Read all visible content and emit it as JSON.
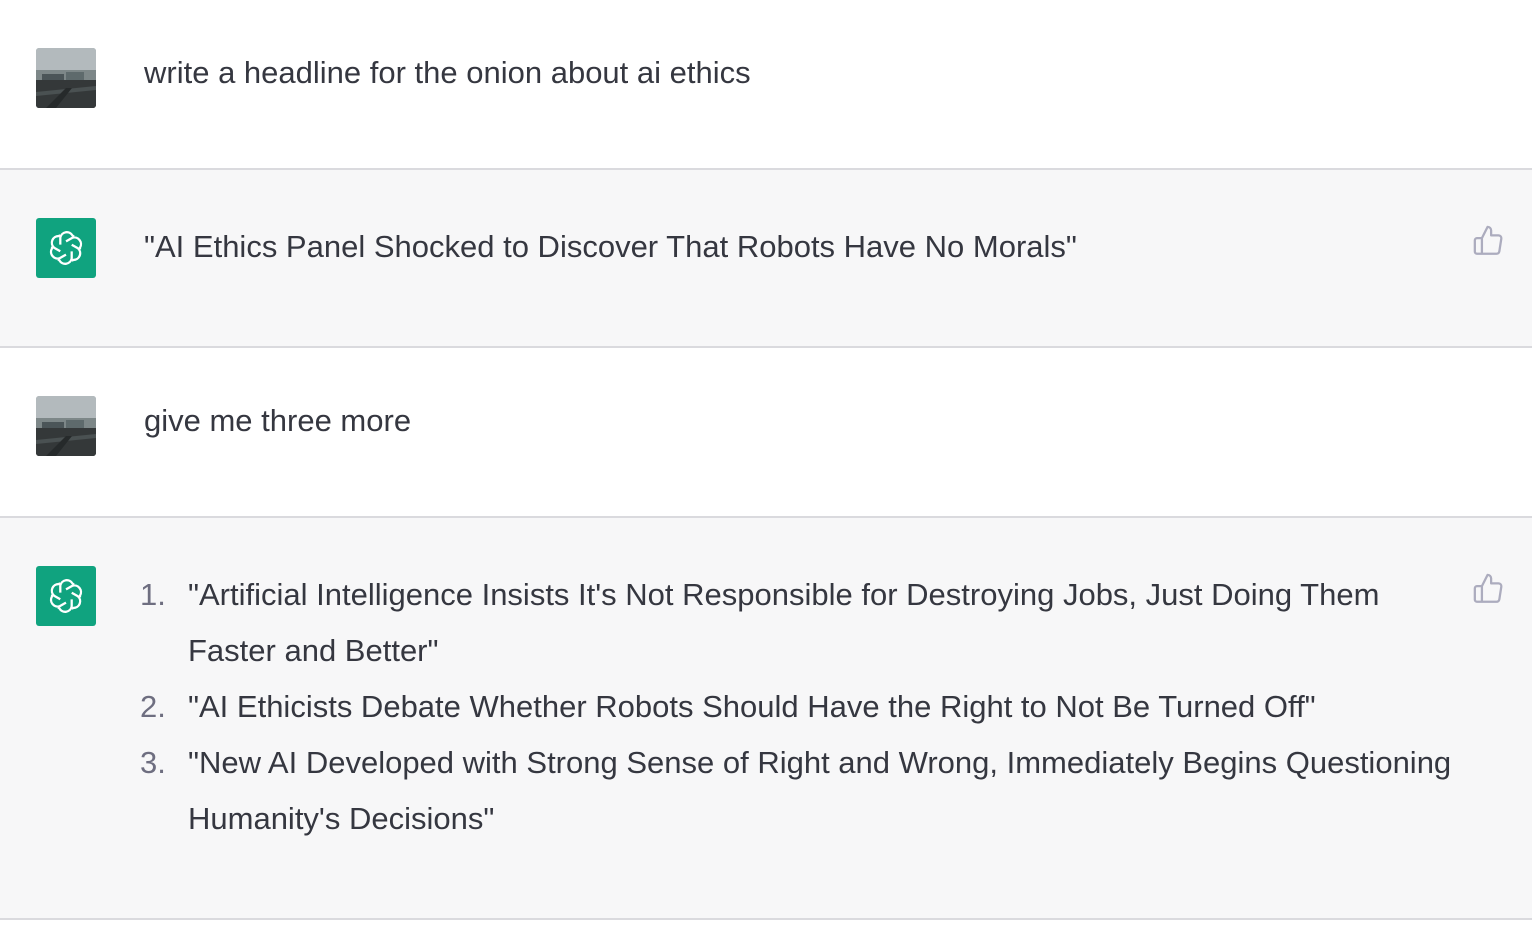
{
  "conversation": {
    "messages": [
      {
        "role": "user",
        "text": "write a headline for the onion about ai ethics"
      },
      {
        "role": "assistant",
        "text": "\"AI Ethics Panel Shocked to Discover That Robots Have No Morals\""
      },
      {
        "role": "user",
        "text": "give me three more"
      },
      {
        "role": "assistant",
        "items": [
          {
            "num": "1.",
            "text": "\"Artificial Intelligence Insists It's Not Responsible for Destroying Jobs, Just Doing Them Faster and Better\""
          },
          {
            "num": "2.",
            "text": "\"AI Ethicists Debate Whether Robots Should Have the Right to Not Be Turned Off\""
          },
          {
            "num": "3.",
            "text": "\"New AI Developed with Strong Sense of Right and Wrong, Immediately Begins Questioning Humanity's Decisions\""
          }
        ]
      }
    ]
  },
  "icons": {
    "user_avatar": "user-photo-avatar",
    "assistant_avatar": "openai-logo-icon",
    "feedback": "thumbs-up-icon"
  },
  "colors": {
    "assistant_bg": "#f7f7f8",
    "user_bg": "#ffffff",
    "brand_green": "#10a37f",
    "text": "#353740",
    "divider": "#dadade"
  }
}
